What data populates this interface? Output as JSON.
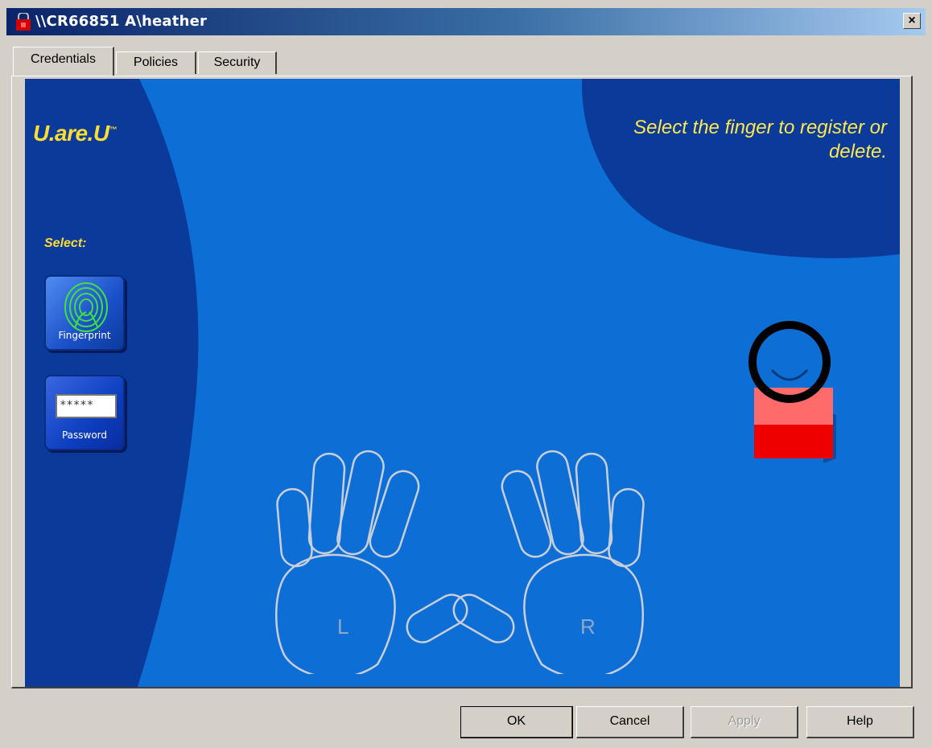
{
  "window": {
    "title": "\\\\CR66851 A\\heather",
    "close_glyph": "×"
  },
  "tabs": [
    {
      "label": "Credentials",
      "active": true
    },
    {
      "label": "Policies",
      "active": false
    },
    {
      "label": "Security",
      "active": false
    }
  ],
  "canvas": {
    "logo": "U.are.U",
    "logo_mark": "™",
    "instruction": "Select the finger to register or delete.",
    "select_label": "Select:",
    "credentials": [
      {
        "label": "Fingerprint",
        "icon": "fingerprint-icon"
      },
      {
        "label": "Password",
        "icon": "password-field-icon",
        "masked_value": "*****"
      }
    ],
    "hands": {
      "left_label": "L",
      "right_label": "R"
    },
    "colors": {
      "bg": "#0d6fd6",
      "dark": "#0a3a9a",
      "accent": "#ffdd33"
    }
  },
  "buttons": {
    "ok": "OK",
    "cancel": "Cancel",
    "apply": "Apply",
    "help": "Help"
  }
}
